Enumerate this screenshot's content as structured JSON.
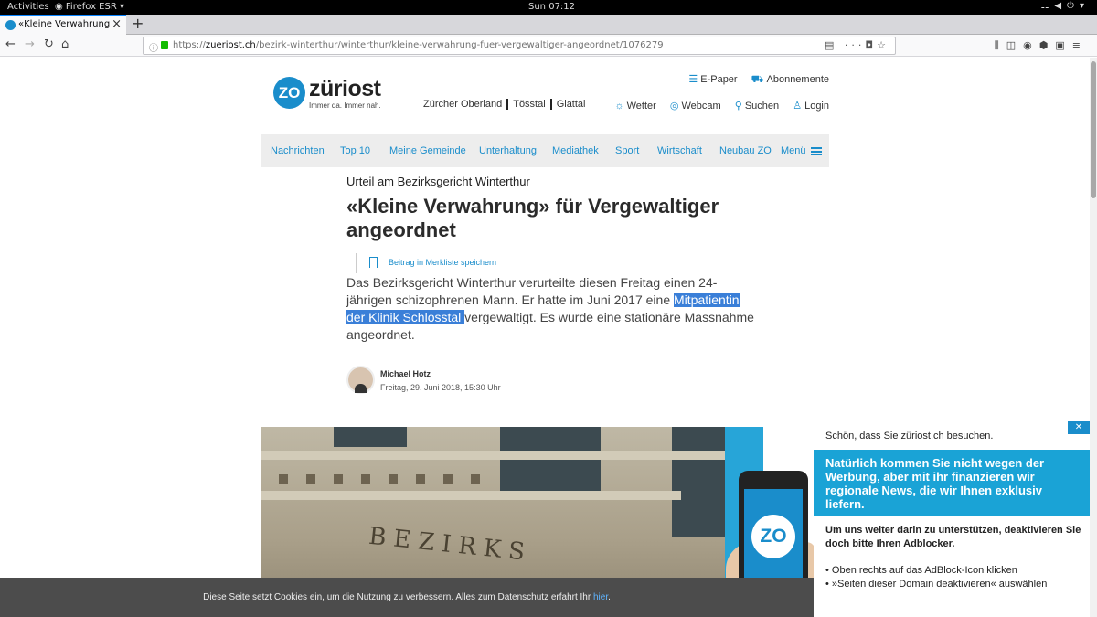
{
  "system_bar": {
    "activities": "Activities",
    "app": "Firefox ESR",
    "clock": "Sun 07:12"
  },
  "browser": {
    "tab_title": "«Kleine Verwahrung» für",
    "url_prefix": "https://",
    "url_host": "zueriost.ch",
    "url_path": "/bezirk-winterthur/winterthur/kleine-verwahrung-fuer-vergewaltiger-angeordnet/1076279"
  },
  "site": {
    "logo_mark": "ZO",
    "logo_name": "züriost",
    "slogan": "Immer da. Immer nah.",
    "regions": [
      "Zürcher Oberland",
      "Tösstal",
      "Glattal"
    ],
    "top_links": [
      {
        "icon": "epaper-icon",
        "label": "E-Paper"
      },
      {
        "icon": "cart-icon",
        "label": "Abonnemente"
      }
    ],
    "util_links": [
      {
        "icon": "sun-icon",
        "label": "Wetter"
      },
      {
        "icon": "webcam-icon",
        "label": "Webcam"
      },
      {
        "icon": "search-icon",
        "label": "Suchen"
      },
      {
        "icon": "user-icon",
        "label": "Login"
      }
    ],
    "nav": [
      "Nachrichten",
      "Top 10",
      "Meine Gemeinde",
      "Unterhaltung",
      "Mediathek",
      "Sport",
      "Wirtschaft",
      "Neubau ZO",
      "Menü"
    ]
  },
  "article": {
    "kicker": "Urteil am Bezirksgericht Winterthur",
    "headline": "«Kleine Verwahrung» für Vergewaltiger angeordnet",
    "bookmark_label": "Beitrag in Merkliste speichern",
    "lead_before": "Das Bezirksgericht Winterthur verurteilte diesen Freitag einen 24-jährigen schizophrenen Mann. Er hatte im Juni 2017 eine ",
    "lead_selected": "Mitpatientin der Klinik Schlosstal ",
    "lead_after": "vergewaltigt. Es wurde eine stationäre Massnahme angeordnet.",
    "author": "Michael Hotz",
    "date": "Freitag, 29. Juni 2018, 15:30 Uhr",
    "photo_text": "BEZIRKS"
  },
  "adblock": {
    "thanks": "Schön, dass Sie züriost.ch besuchen.",
    "close": "✕",
    "box": "Natürlich kommen Sie nicht wegen der Werbung, aber mit ihr finanzieren wir regionale News, die wir Ihnen exklusiv liefern.",
    "request": "Um uns weiter darin zu unterstützen, deaktivieren Sie doch bitte Ihren Adblocker.",
    "steps": [
      "Oben rechts auf das AdBlock-Icon klicken",
      "»Seiten dieser Domain deaktivieren« auswählen"
    ],
    "phone_mark": "ZO"
  },
  "cookie": {
    "text": "Diese Seite setzt Cookies ein, um die Nutzung zu verbessern. Alles zum Datenschutz erfahrt Ihr ",
    "link": "hier",
    "end": "."
  },
  "colors": {
    "brand": "#1a8dcb",
    "selection": "#3a7fd8",
    "ad_blue": "#1aa3d6"
  }
}
